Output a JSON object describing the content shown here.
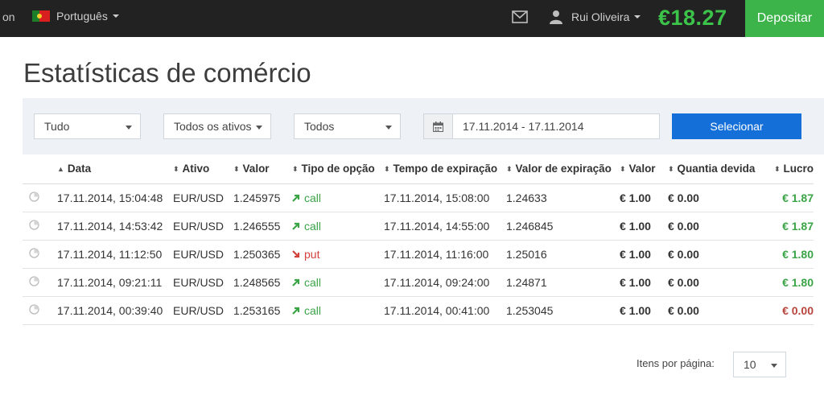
{
  "topbar": {
    "left_cut_text": "on",
    "language": "Português",
    "user_name": "Rui Oliveira",
    "balance": "€18.27",
    "deposit_label": "Depositar",
    "icons": [
      "portugal-flag-icon",
      "mail-icon",
      "user-icon"
    ]
  },
  "page": {
    "title": "Estatísticas de comércio"
  },
  "filters": {
    "type": "Tudo",
    "asset": "Todos os ativos",
    "direction": "Todos",
    "date_range": "17.11.2014 - 17.11.2014",
    "select_label": "Selecionar",
    "icons": [
      "calendar-icon"
    ]
  },
  "table": {
    "headers": {
      "data": "Data",
      "ativo": "Ativo",
      "valor": "Valor",
      "tipo": "Tipo de opção",
      "tempo": "Tempo de expiração",
      "valor_exp": "Valor de expiração",
      "valor2": "Valor",
      "quantia": "Quantia devida",
      "lucro": "Lucro"
    },
    "rows": [
      {
        "data": "17.11.2014, 15:04:48",
        "ativo": "EUR/USD",
        "valor": "1.245975",
        "tipo": "call",
        "tempo": "17.11.2014, 15:08:00",
        "valor_exp": "1.24633",
        "valor2": "€ 1.00",
        "quantia": "€ 0.00",
        "lucro": "€ 1.87"
      },
      {
        "data": "17.11.2014, 14:53:42",
        "ativo": "EUR/USD",
        "valor": "1.246555",
        "tipo": "call",
        "tempo": "17.11.2014, 14:55:00",
        "valor_exp": "1.246845",
        "valor2": "€ 1.00",
        "quantia": "€ 0.00",
        "lucro": "€ 1.87"
      },
      {
        "data": "17.11.2014, 11:12:50",
        "ativo": "EUR/USD",
        "valor": "1.250365",
        "tipo": "put",
        "tempo": "17.11.2014, 11:16:00",
        "valor_exp": "1.25016",
        "valor2": "€ 1.00",
        "quantia": "€ 0.00",
        "lucro": "€ 1.80"
      },
      {
        "data": "17.11.2014, 09:21:11",
        "ativo": "EUR/USD",
        "valor": "1.248565",
        "tipo": "call",
        "tempo": "17.11.2014, 09:24:00",
        "valor_exp": "1.24871",
        "valor2": "€ 1.00",
        "quantia": "€ 0.00",
        "lucro": "€ 1.80"
      },
      {
        "data": "17.11.2014, 00:39:40",
        "ativo": "EUR/USD",
        "valor": "1.253165",
        "tipo": "call",
        "tempo": "17.11.2014, 00:41:00",
        "valor_exp": "1.253045",
        "valor2": "€ 1.00",
        "quantia": "€ 0.00",
        "lucro": "€ 0.00"
      }
    ]
  },
  "pagination": {
    "label": "Itens por página:",
    "value": "10"
  },
  "colors": {
    "topbar_bg": "#222222",
    "balance": "#3cc34a",
    "deposit_bg": "#3cb44a",
    "select_bg": "#1470d8",
    "call": "#3aa447",
    "put": "#d2413a",
    "profit_zero": "#b8453d"
  }
}
